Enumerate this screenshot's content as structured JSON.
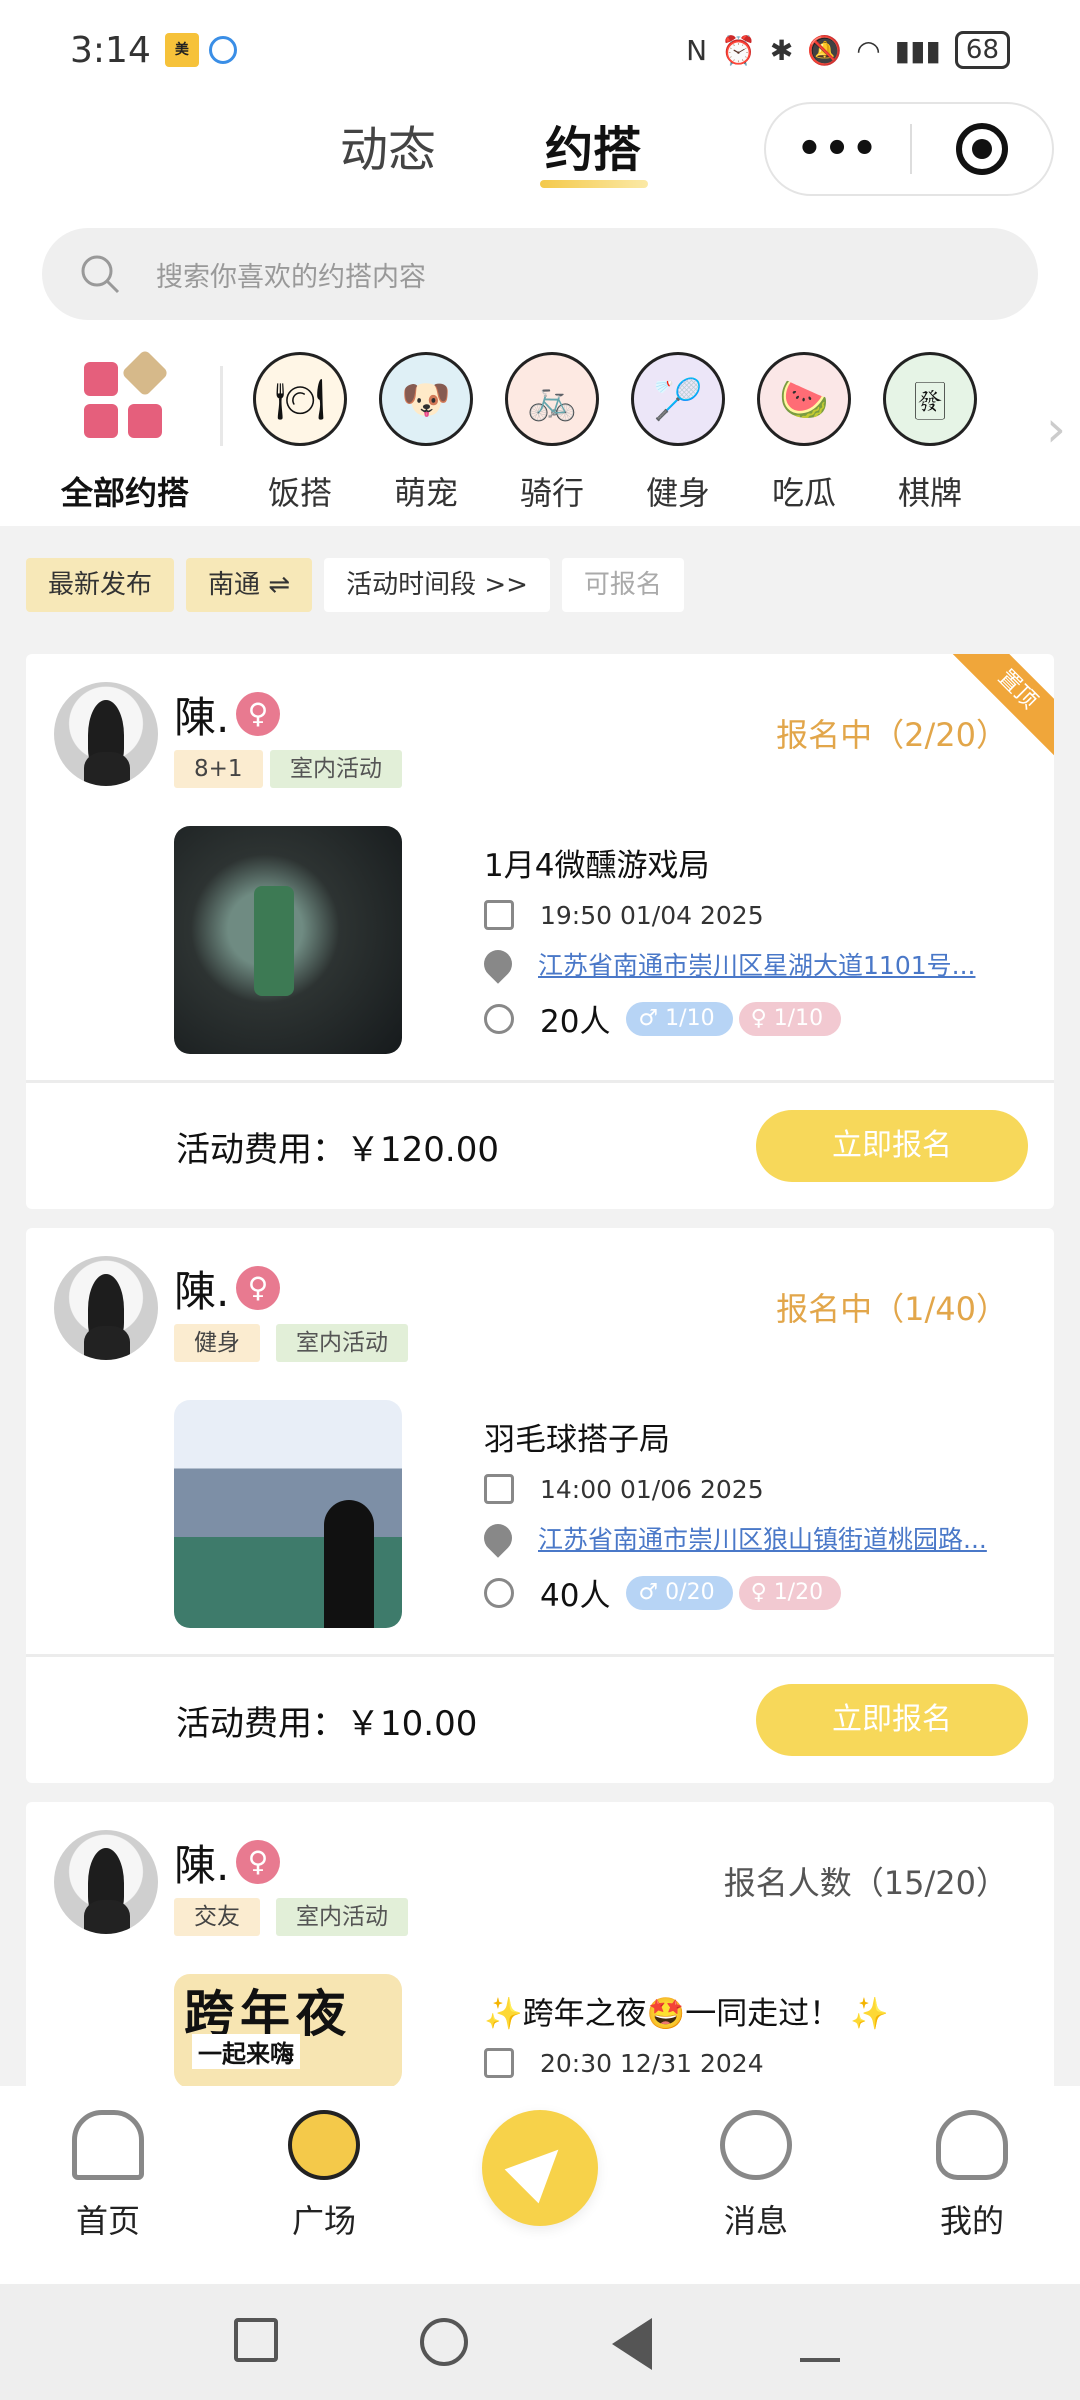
{
  "status_bar": {
    "time": "3:14",
    "battery": "68"
  },
  "header": {
    "tab_dynamic": "动态",
    "tab_yuedai": "约搭",
    "more": "•••"
  },
  "search": {
    "placeholder": "搜索你喜欢的约搭内容"
  },
  "categories": [
    {
      "label": "全部约搭",
      "icon": "grid-icon"
    },
    {
      "label": "饭搭",
      "icon": "meal-icon"
    },
    {
      "label": "萌宠",
      "icon": "pet-icon"
    },
    {
      "label": "骑行",
      "icon": "bike-icon"
    },
    {
      "label": "健身",
      "icon": "fitness-icon"
    },
    {
      "label": "吃瓜",
      "icon": "watermelon-icon"
    },
    {
      "label": "棋牌",
      "icon": "mahjong-icon"
    }
  ],
  "filters": {
    "latest": "最新发布",
    "city": "南通 ⇌",
    "time_range": "活动时间段 >>",
    "available": "可报名"
  },
  "cards": [
    {
      "user": "陳.",
      "tags": [
        "8+1",
        "室内活动"
      ],
      "status": "报名中（2/20）",
      "pinned": "置顶",
      "title": "1月4微醺游戏局",
      "datetime": "19:50 01/04 2025",
      "address": "江苏省南通市崇川区星湖大道1101号...",
      "people": "20人",
      "male": "1/10",
      "female": "1/10",
      "fee": "活动费用：￥120.00",
      "join": "立即报名"
    },
    {
      "user": "陳.",
      "tags": [
        "健身",
        "室内活动"
      ],
      "status": "报名中（1/40）",
      "title": "羽毛球搭子局",
      "datetime": "14:00 01/06 2025",
      "address": "江苏省南通市崇川区狼山镇街道桃园路...",
      "people": "40人",
      "male": "0/20",
      "female": "1/20",
      "fee": "活动费用：￥10.00",
      "join": "立即报名"
    },
    {
      "user": "陳.",
      "tags": [
        "交友",
        "室内活动"
      ],
      "status": "报名人数（15/20）",
      "title": "✨跨年之夜🤩一同走过！ ✨",
      "datetime": "20:30 12/31 2024",
      "poster_text": "跨年夜",
      "poster_sub": "一起来嗨"
    }
  ],
  "bottom_nav": {
    "home": "首页",
    "square": "广场",
    "messages": "消息",
    "me": "我的"
  },
  "colors": {
    "accent": "#f7d85a",
    "status_gold": "#e2a64a",
    "link": "#4a78c8"
  }
}
